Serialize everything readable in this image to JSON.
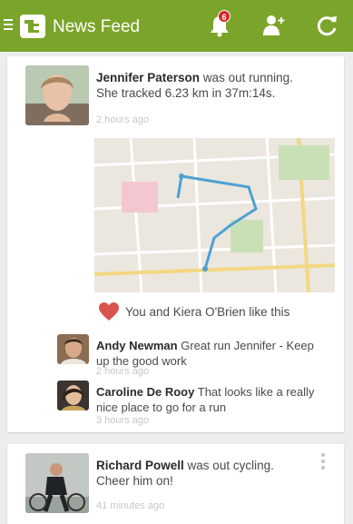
{
  "appbar": {
    "title": "News Feed",
    "notification_count": "6",
    "accent": "#7aa52a",
    "icons": [
      "menu-icon",
      "app-logo-icon",
      "bell-icon",
      "add-friend-icon",
      "refresh-icon"
    ]
  },
  "feed": [
    {
      "author": "Jennifer Paterson",
      "text": "was out running. She tracked 6.23 km in 37m:14s.",
      "time": "2 hours ago",
      "likes": "You and Kiera O'Brien like this",
      "comments": [
        {
          "author": "Andy Newman",
          "text": "Great run Jennifer - Keep up the good work",
          "time": "2 hours ago"
        },
        {
          "author": "Caroline De Rooy",
          "text": "That looks like a really nice place to go for a run",
          "time": "3 hours ago"
        }
      ]
    },
    {
      "author": "Richard Powell",
      "text": "was out cycling. Cheer him on!",
      "time": "41 minutes ago"
    }
  ]
}
